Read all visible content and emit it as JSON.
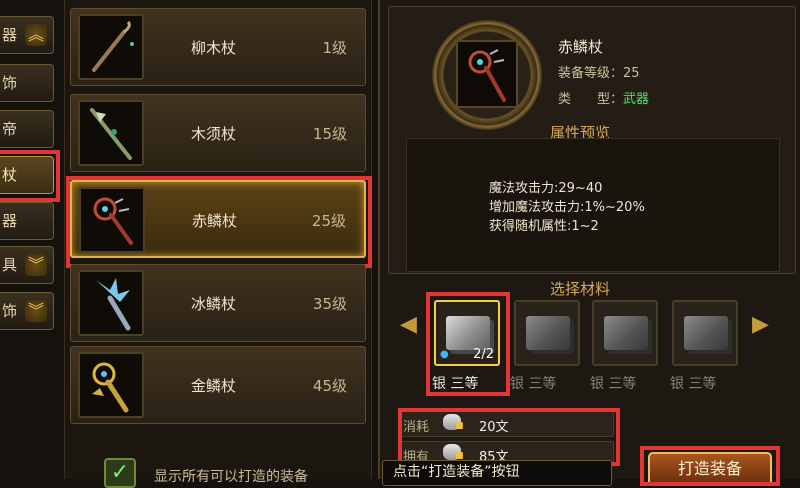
{
  "categories": [
    {
      "label": "器",
      "chevron": "chevron-up-icon"
    },
    {
      "label": "饰",
      "chevron": ""
    },
    {
      "label": "帝",
      "chevron": ""
    },
    {
      "label": "杖",
      "chevron": ""
    },
    {
      "label": "器",
      "chevron": ""
    },
    {
      "label": "具",
      "chevron": "chevron-down-icon"
    },
    {
      "label": "饰",
      "chevron": "chevron-down-icon"
    }
  ],
  "items": [
    {
      "name": "柳木杖",
      "level": "1级",
      "icon": "willow-staff-icon"
    },
    {
      "name": "木须杖",
      "level": "15级",
      "icon": "beard-staff-icon"
    },
    {
      "name": "赤鳞杖",
      "level": "25级",
      "icon": "red-scale-staff-icon"
    },
    {
      "name": "冰鳞杖",
      "level": "35级",
      "icon": "ice-scale-staff-icon"
    },
    {
      "name": "金鳞杖",
      "level": "45级",
      "icon": "gold-scale-staff-icon"
    }
  ],
  "selected_item": {
    "name": "赤鳞杖",
    "level_label": "装备等级：",
    "level_value": "25",
    "type_label": "类　　型：",
    "type_value": "武器"
  },
  "attr_preview": {
    "title": "属性预览",
    "lines": [
      "魔法攻击力:29~40",
      "增加魔法攻击力:1%~20%",
      "获得随机属性:1~2"
    ]
  },
  "materials": {
    "title": "选择材料",
    "slots": [
      {
        "label": "银 三等",
        "count": "2/2",
        "selected": true
      },
      {
        "label": "银 三等",
        "count": "",
        "selected": false
      },
      {
        "label": "银 三等",
        "count": "",
        "selected": false
      },
      {
        "label": "银 三等",
        "count": "",
        "selected": false
      }
    ]
  },
  "cost": {
    "consume_label": "消耗",
    "consume_value": "20文",
    "own_label": "拥有",
    "own_value": "85文"
  },
  "buttons": {
    "craft": "打造装备"
  },
  "tooltip": "点击“打造装备”按钮",
  "show_all_label": "显示所有可以打造的装备",
  "colors": {
    "highlight": "#e23636",
    "gold": "#e0b54c",
    "type_green": "#4fe06a"
  }
}
